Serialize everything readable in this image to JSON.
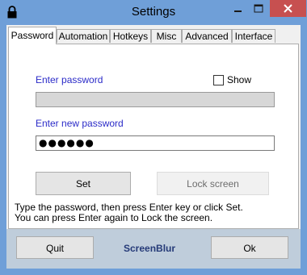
{
  "window": {
    "title": "Settings",
    "accent_color": "#6f9fd8",
    "close_color": "#c75050",
    "icons": {
      "app": "lock-icon",
      "minimize": "minimize-icon",
      "maximize": "maximize-icon",
      "close": "close-icon"
    }
  },
  "tabs": [
    {
      "label": "Password",
      "selected": true
    },
    {
      "label": "Automation"
    },
    {
      "label": "Hotkeys"
    },
    {
      "label": "Misc"
    },
    {
      "label": "Advanced"
    },
    {
      "label": "Interface"
    }
  ],
  "password": {
    "enter_label": "Enter password",
    "show_label": "Show",
    "show_checked": false,
    "current_value": "",
    "new_label": "Enter new password",
    "new_value": "●●●●●●",
    "set_button": "Set",
    "lock_button": "Lock screen",
    "hint_line1": "Type the password, then press Enter key or click Set.",
    "hint_line2": "You can press Enter again to Lock the screen."
  },
  "footer": {
    "quit_button": "Quit",
    "brand": "ScreenBlur",
    "ok_button": "Ok"
  }
}
